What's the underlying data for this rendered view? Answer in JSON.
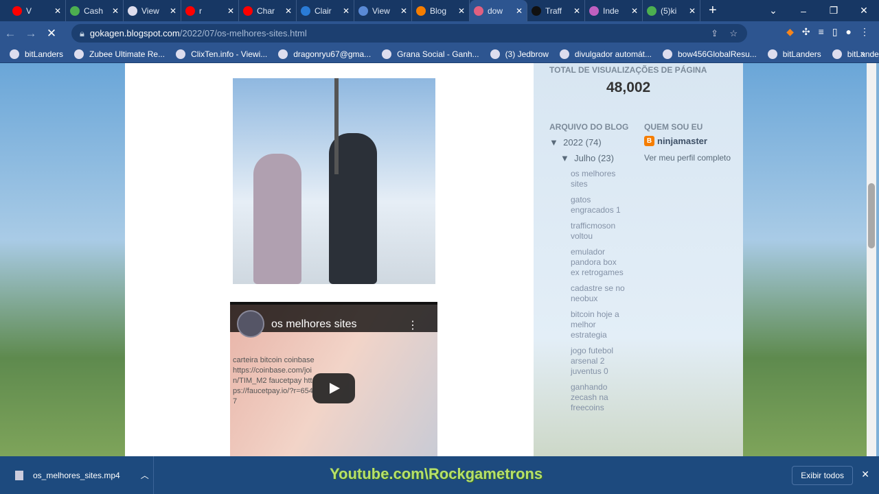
{
  "tabs": [
    {
      "label": "V",
      "color": "#ff0000"
    },
    {
      "label": "Cash",
      "color": "#4caf50"
    },
    {
      "label": "View",
      "color": "#dde"
    },
    {
      "label": "r",
      "color": "#ff0000"
    },
    {
      "label": "Char",
      "color": "#ff0000"
    },
    {
      "label": "Clair",
      "color": "#2a7bd6"
    },
    {
      "label": "View",
      "color": "#5a8ad6"
    },
    {
      "label": "Blog",
      "color": "#f57d00"
    },
    {
      "label": "dow",
      "color": "#e06080",
      "active": true
    },
    {
      "label": "Traff",
      "color": "#111"
    },
    {
      "label": "Inde",
      "color": "#c060c0"
    },
    {
      "label": "(5)ki",
      "color": "#4caf50"
    }
  ],
  "address": {
    "host": "gokagen.blogspot.com",
    "path": "/2022/07/os-melhores-sites.html"
  },
  "bookmarks": [
    "bitLanders",
    "Zubee Ultimate Re...",
    "ClixTen.info - Viewi...",
    "dragonryu67@gma...",
    "Grana Social - Ganh...",
    "(3) Jedbrow",
    "divulgador automát...",
    "bow456GlobalResu...",
    "bitLanders",
    "bitLanders"
  ],
  "video": {
    "title": "os melhores sites",
    "description": "carteira bitcoin coinbase https://coinbase.com/join/TIM_M2 faucetpay https://faucetpay.io/?r=6547"
  },
  "sidebar": {
    "stats_heading": "TOTAL DE VISUALIZAÇÕES DE PÁGINA",
    "stats_value": "48,002",
    "archive_heading": "ARQUIVO DO BLOG",
    "year": "2022 (74)",
    "month": "Julho (23)",
    "posts": [
      "os melhores sites",
      "gatos engracados 1",
      "trafficmoson voltou",
      "emulador pandora box ex retrogames",
      "cadastre se no neobux",
      "bitcoin hoje a melhor estrategia",
      "jogo futebol arsenal 2 juventus 0",
      "ganhando zecash na freecoins"
    ],
    "about_heading": "QUEM SOU EU",
    "profile_name": "ninjamaster",
    "profile_link": "Ver meu perfil completo"
  },
  "downloads": {
    "file": "os_melhores_sites.mp4",
    "show_all": "Exibir todos",
    "watermark": "Youtube.com\\Rockgametrons"
  }
}
